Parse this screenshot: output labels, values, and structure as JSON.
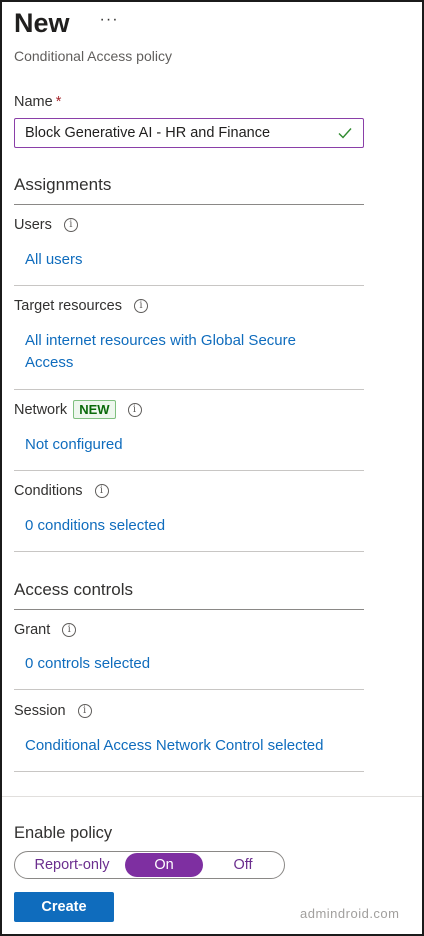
{
  "header": {
    "title": "New",
    "more": "···",
    "subtitle": "Conditional Access policy"
  },
  "name_field": {
    "label": "Name",
    "required_mark": "*",
    "value": "Block Generative AI - HR and Finance"
  },
  "assignments": {
    "heading": "Assignments",
    "users": {
      "label": "Users",
      "value": "All users"
    },
    "target_resources": {
      "label": "Target resources",
      "value_line1": "All internet resources with Global Secure",
      "value_line2": "Access"
    },
    "network": {
      "label": "Network",
      "badge": "NEW",
      "value": "Not configured"
    },
    "conditions": {
      "label": "Conditions",
      "value": "0 conditions selected"
    }
  },
  "access_controls": {
    "heading": "Access controls",
    "grant": {
      "label": "Grant",
      "value": "0 controls selected"
    },
    "session": {
      "label": "Session",
      "value": "Conditional Access Network Control selected"
    }
  },
  "enable_policy": {
    "label": "Enable policy",
    "options": [
      "Report-only",
      "On",
      "Off"
    ],
    "selected": "On"
  },
  "actions": {
    "create": "Create"
  },
  "watermark": "admindroid.com",
  "colors": {
    "link": "#0f6cbd",
    "toggle_selected": "#7e2fa1",
    "button": "#0f6cbd",
    "badge_text": "#0b6a0b"
  }
}
